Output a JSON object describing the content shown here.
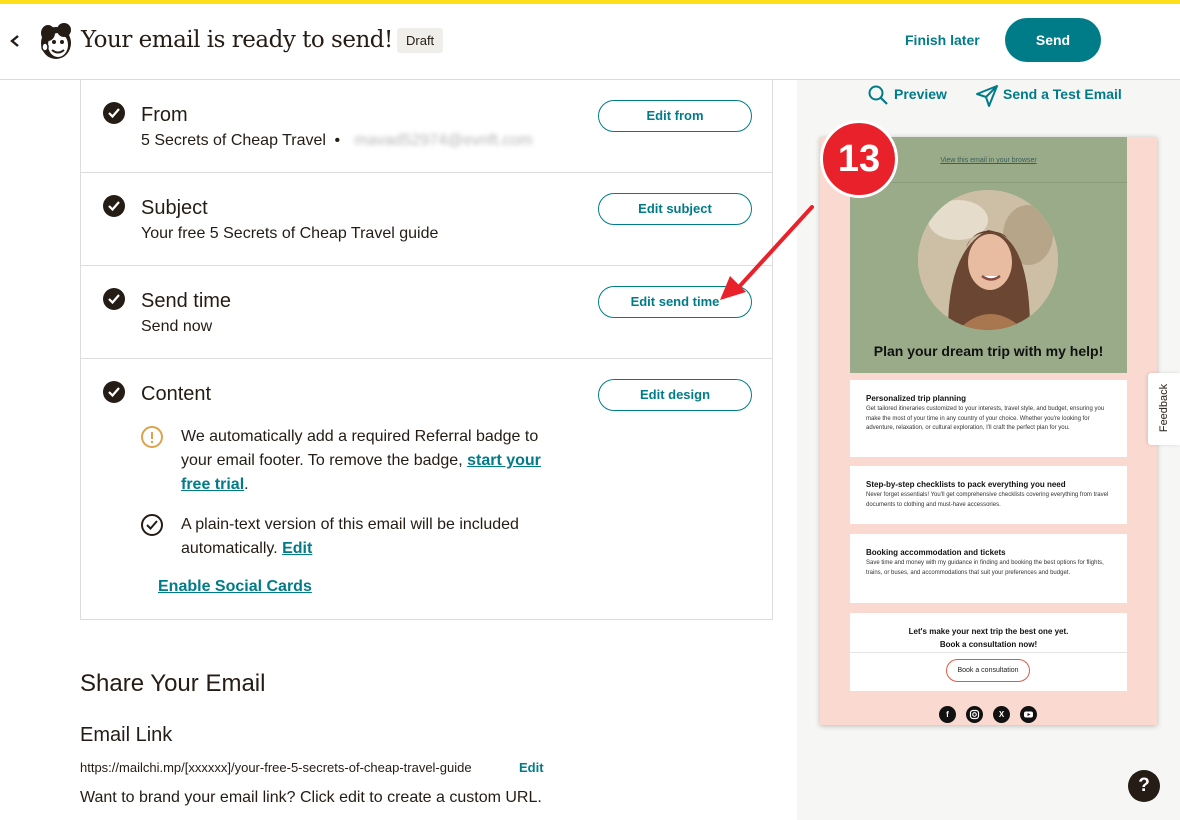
{
  "header": {
    "title": "Your email is ready to send!",
    "status_badge": "Draft",
    "finish_later": "Finish later",
    "send": "Send"
  },
  "checklist": {
    "from": {
      "title": "From",
      "name": "5 Secrets of Cheap Travel",
      "separator": "•",
      "email": "mavad52974@evnft.com",
      "button": "Edit from"
    },
    "subject": {
      "title": "Subject",
      "value": "Your free 5 Secrets of Cheap Travel guide",
      "button": "Edit subject"
    },
    "send_time": {
      "title": "Send time",
      "value": "Send now",
      "button": "Edit send time"
    },
    "content": {
      "title": "Content",
      "button": "Edit design",
      "referral_text": "We automatically add a required Referral badge to your email footer. To remove the badge,",
      "referral_link": "start your free trial",
      "referral_end": ".",
      "plaintext_text": "A plain-text version of this email will be included automatically.",
      "plaintext_link": "Edit",
      "social_cards": "Enable Social Cards"
    }
  },
  "share": {
    "heading": "Share Your Email",
    "email_link_heading": "Email Link",
    "url": "https://mailchi.mp/[xxxxxx]/your-free-5-secrets-of-cheap-travel-guide",
    "edit": "Edit",
    "brand_text": "Want to brand your email link? Click edit to create a custom URL."
  },
  "preview_panel": {
    "preview": "Preview",
    "test_email": "Send a Test Email",
    "step_badge": "13",
    "feedback": "Feedback",
    "help": "?"
  },
  "email_preview": {
    "view_link": "View this email in your browser",
    "hero_title": "Plan your dream trip with my help!",
    "sections": [
      {
        "title": "Personalized trip planning",
        "body": "Get tailored itineraries customized to your interests, travel style, and budget, ensuring you make the most of your time in any country of your choice. Whether you're looking for adventure, relaxation, or cultural exploration, I'll craft the perfect plan for you."
      },
      {
        "title": "Step-by-step checklists to pack everything you need",
        "body": "Never forget essentials! You'll get comprehensive checklists covering everything from travel documents to clothing and must-have accessories."
      },
      {
        "title": "Booking accommodation and tickets",
        "body": "Save time and money with my guidance in finding and booking the best options for flights, trains, or buses, and accommodations that suit your preferences and budget."
      }
    ],
    "cta_line1": "Let's make your next trip the best one yet.",
    "cta_line2": "Book a consultation now!",
    "cta_button": "Book a consultation",
    "social_icons": [
      "facebook-icon",
      "instagram-icon",
      "x-icon",
      "youtube-icon"
    ]
  },
  "colors": {
    "accent": "#007c89",
    "brand_yellow": "#ffe01b",
    "annotation_red": "#e8212b",
    "hero_green": "#9aab8a",
    "email_background": "#fad9d0"
  }
}
